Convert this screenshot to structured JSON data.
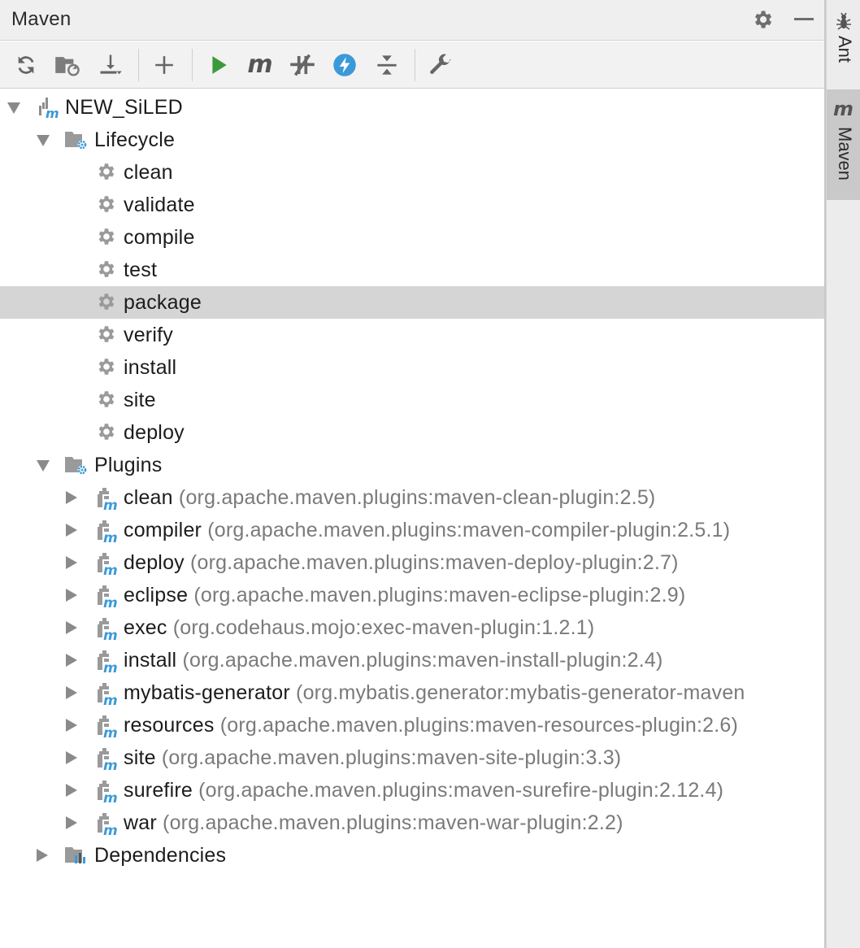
{
  "window": {
    "title": "Maven"
  },
  "toolbar": {
    "buttons": [
      {
        "name": "reload-all-icon"
      },
      {
        "name": "generate-sources-icon"
      },
      {
        "name": "download-icon"
      },
      {
        "name": "add-icon"
      },
      {
        "name": "run-icon"
      },
      {
        "name": "execute-goal-icon"
      },
      {
        "name": "skip-tests-icon"
      },
      {
        "name": "offline-mode-icon"
      },
      {
        "name": "collapse-all-icon"
      },
      {
        "name": "settings-wrench-icon"
      }
    ]
  },
  "tree": {
    "project": "NEW_SiLED",
    "lifecycle": {
      "label": "Lifecycle",
      "goals": [
        "clean",
        "validate",
        "compile",
        "test",
        "package",
        "verify",
        "install",
        "site",
        "deploy"
      ],
      "selected": "package"
    },
    "plugins": {
      "label": "Plugins",
      "items": [
        {
          "name": "clean",
          "coord": "(org.apache.maven.plugins:maven-clean-plugin:2.5)"
        },
        {
          "name": "compiler",
          "coord": "(org.apache.maven.plugins:maven-compiler-plugin:2.5.1)"
        },
        {
          "name": "deploy",
          "coord": "(org.apache.maven.plugins:maven-deploy-plugin:2.7)"
        },
        {
          "name": "eclipse",
          "coord": "(org.apache.maven.plugins:maven-eclipse-plugin:2.9)"
        },
        {
          "name": "exec",
          "coord": "(org.codehaus.mojo:exec-maven-plugin:1.2.1)"
        },
        {
          "name": "install",
          "coord": "(org.apache.maven.plugins:maven-install-plugin:2.4)"
        },
        {
          "name": "mybatis-generator",
          "coord": "(org.mybatis.generator:mybatis-generator-maven"
        },
        {
          "name": "resources",
          "coord": "(org.apache.maven.plugins:maven-resources-plugin:2.6)"
        },
        {
          "name": "site",
          "coord": "(org.apache.maven.plugins:maven-site-plugin:3.3)"
        },
        {
          "name": "surefire",
          "coord": "(org.apache.maven.plugins:maven-surefire-plugin:2.12.4)"
        },
        {
          "name": "war",
          "coord": "(org.apache.maven.plugins:maven-war-plugin:2.2)"
        }
      ]
    },
    "dependencies": {
      "label": "Dependencies"
    }
  },
  "side_strip": {
    "tabs": [
      {
        "label": "Ant",
        "icon": "ant-icon",
        "active": false
      },
      {
        "label": "Maven",
        "icon": "maven-m-icon",
        "active": true
      }
    ]
  },
  "colors": {
    "accent_blue": "#3a9ad9",
    "run_green": "#3c9a3c",
    "selection": "#d5d5d5"
  }
}
